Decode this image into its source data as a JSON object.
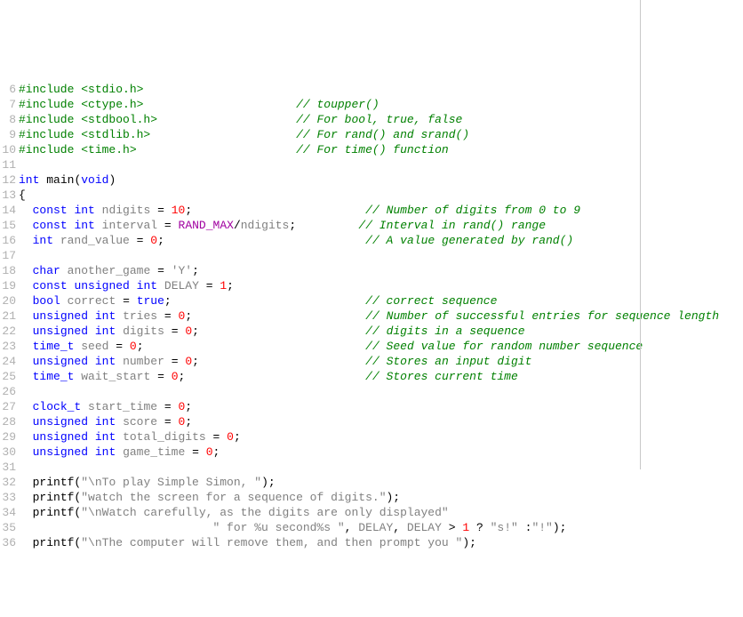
{
  "lines": [
    {
      "n": "6",
      "tokens": [
        [
          "pp",
          "#include "
        ],
        [
          "hdr",
          "<stdio.h>"
        ]
      ]
    },
    {
      "n": "7",
      "tokens": [
        [
          "pp",
          "#include "
        ],
        [
          "hdr",
          "<ctype.h>"
        ],
        [
          "",
          "                      "
        ],
        [
          "cmt",
          "// toupper()"
        ]
      ]
    },
    {
      "n": "8",
      "tokens": [
        [
          "pp",
          "#include "
        ],
        [
          "hdr",
          "<stdbool.h>"
        ],
        [
          "",
          "                    "
        ],
        [
          "cmt",
          "// For bool, true, false"
        ]
      ]
    },
    {
      "n": "9",
      "tokens": [
        [
          "pp",
          "#include "
        ],
        [
          "hdr",
          "<stdlib.h>"
        ],
        [
          "",
          "                     "
        ],
        [
          "cmt",
          "// For rand() and srand()"
        ]
      ]
    },
    {
      "n": "10",
      "tokens": [
        [
          "pp",
          "#include "
        ],
        [
          "hdr",
          "<time.h>"
        ],
        [
          "",
          "                       "
        ],
        [
          "cmt",
          "// For time() function"
        ]
      ]
    },
    {
      "n": "11",
      "tokens": []
    },
    {
      "n": "12",
      "tokens": [
        [
          "kw",
          "int"
        ],
        [
          "",
          " "
        ],
        [
          "fn",
          "main"
        ],
        [
          "op",
          "("
        ],
        [
          "kw",
          "void"
        ],
        [
          "op",
          ")"
        ]
      ]
    },
    {
      "n": "13",
      "tokens": [
        [
          "op",
          "{"
        ]
      ]
    },
    {
      "n": "14",
      "tokens": [
        [
          "",
          "  "
        ],
        [
          "kw",
          "const"
        ],
        [
          "",
          " "
        ],
        [
          "kw",
          "int"
        ],
        [
          "",
          " "
        ],
        [
          "id",
          "ndigits"
        ],
        [
          "",
          " "
        ],
        [
          "op",
          "="
        ],
        [
          "",
          " "
        ],
        [
          "num",
          "10"
        ],
        [
          "op",
          ";"
        ],
        [
          "",
          "                         "
        ],
        [
          "cmt",
          "// Number of digits from 0 to 9"
        ]
      ]
    },
    {
      "n": "15",
      "tokens": [
        [
          "",
          "  "
        ],
        [
          "kw",
          "const"
        ],
        [
          "",
          " "
        ],
        [
          "kw",
          "int"
        ],
        [
          "",
          " "
        ],
        [
          "id",
          "interval"
        ],
        [
          "",
          " "
        ],
        [
          "op",
          "="
        ],
        [
          "",
          " "
        ],
        [
          "mac",
          "RAND_MAX"
        ],
        [
          "op",
          "/"
        ],
        [
          "id",
          "ndigits"
        ],
        [
          "op",
          ";"
        ],
        [
          "",
          "         "
        ],
        [
          "cmt",
          "// Interval in rand() range"
        ]
      ]
    },
    {
      "n": "16",
      "tokens": [
        [
          "",
          "  "
        ],
        [
          "kw",
          "int"
        ],
        [
          "",
          " "
        ],
        [
          "id",
          "rand_value"
        ],
        [
          "",
          " "
        ],
        [
          "op",
          "="
        ],
        [
          "",
          " "
        ],
        [
          "num",
          "0"
        ],
        [
          "op",
          ";"
        ],
        [
          "",
          "                             "
        ],
        [
          "cmt",
          "// A value generated by rand()"
        ]
      ]
    },
    {
      "n": "17",
      "tokens": []
    },
    {
      "n": "18",
      "tokens": [
        [
          "",
          "  "
        ],
        [
          "kw",
          "char"
        ],
        [
          "",
          " "
        ],
        [
          "id",
          "another_game"
        ],
        [
          "",
          " "
        ],
        [
          "op",
          "="
        ],
        [
          "",
          " "
        ],
        [
          "str",
          "'Y'"
        ],
        [
          "op",
          ";"
        ]
      ]
    },
    {
      "n": "19",
      "tokens": [
        [
          "",
          "  "
        ],
        [
          "kw",
          "const"
        ],
        [
          "",
          " "
        ],
        [
          "kw",
          "unsigned"
        ],
        [
          "",
          " "
        ],
        [
          "kw",
          "int"
        ],
        [
          "",
          " "
        ],
        [
          "id",
          "DELAY"
        ],
        [
          "",
          " "
        ],
        [
          "op",
          "="
        ],
        [
          "",
          " "
        ],
        [
          "num",
          "1"
        ],
        [
          "op",
          ";"
        ]
      ]
    },
    {
      "n": "20",
      "tokens": [
        [
          "",
          "  "
        ],
        [
          "kw",
          "bool"
        ],
        [
          "",
          " "
        ],
        [
          "id",
          "correct"
        ],
        [
          "",
          " "
        ],
        [
          "op",
          "="
        ],
        [
          "",
          " "
        ],
        [
          "kw",
          "true"
        ],
        [
          "op",
          ";"
        ],
        [
          "",
          "                            "
        ],
        [
          "cmt",
          "// correct sequence"
        ]
      ]
    },
    {
      "n": "21",
      "tokens": [
        [
          "",
          "  "
        ],
        [
          "kw",
          "unsigned"
        ],
        [
          "",
          " "
        ],
        [
          "kw",
          "int"
        ],
        [
          "",
          " "
        ],
        [
          "id",
          "tries"
        ],
        [
          "",
          " "
        ],
        [
          "op",
          "="
        ],
        [
          "",
          " "
        ],
        [
          "num",
          "0"
        ],
        [
          "op",
          ";"
        ],
        [
          "",
          "                         "
        ],
        [
          "cmt",
          "// Number of successful entries for sequence length"
        ]
      ]
    },
    {
      "n": "22",
      "tokens": [
        [
          "",
          "  "
        ],
        [
          "kw",
          "unsigned"
        ],
        [
          "",
          " "
        ],
        [
          "kw",
          "int"
        ],
        [
          "",
          " "
        ],
        [
          "id",
          "digits"
        ],
        [
          "",
          " "
        ],
        [
          "op",
          "="
        ],
        [
          "",
          " "
        ],
        [
          "num",
          "0"
        ],
        [
          "op",
          ";"
        ],
        [
          "",
          "                        "
        ],
        [
          "cmt",
          "// digits in a sequence"
        ]
      ]
    },
    {
      "n": "23",
      "tokens": [
        [
          "",
          "  "
        ],
        [
          "ty",
          "time_t"
        ],
        [
          "",
          " "
        ],
        [
          "id",
          "seed"
        ],
        [
          "",
          " "
        ],
        [
          "op",
          "="
        ],
        [
          "",
          " "
        ],
        [
          "num",
          "0"
        ],
        [
          "op",
          ";"
        ],
        [
          "",
          "                                "
        ],
        [
          "cmt",
          "// Seed value for random number sequence"
        ]
      ]
    },
    {
      "n": "24",
      "tokens": [
        [
          "",
          "  "
        ],
        [
          "kw",
          "unsigned"
        ],
        [
          "",
          " "
        ],
        [
          "kw",
          "int"
        ],
        [
          "",
          " "
        ],
        [
          "id",
          "number"
        ],
        [
          "",
          " "
        ],
        [
          "op",
          "="
        ],
        [
          "",
          " "
        ],
        [
          "num",
          "0"
        ],
        [
          "op",
          ";"
        ],
        [
          "",
          "                        "
        ],
        [
          "cmt",
          "// Stores an input digit"
        ]
      ]
    },
    {
      "n": "25",
      "tokens": [
        [
          "",
          "  "
        ],
        [
          "ty",
          "time_t"
        ],
        [
          "",
          " "
        ],
        [
          "id",
          "wait_start"
        ],
        [
          "",
          " "
        ],
        [
          "op",
          "="
        ],
        [
          "",
          " "
        ],
        [
          "num",
          "0"
        ],
        [
          "op",
          ";"
        ],
        [
          "",
          "                          "
        ],
        [
          "cmt",
          "// Stores current time"
        ]
      ]
    },
    {
      "n": "26",
      "tokens": []
    },
    {
      "n": "27",
      "tokens": [
        [
          "",
          "  "
        ],
        [
          "ty",
          "clock_t"
        ],
        [
          "",
          " "
        ],
        [
          "id",
          "start_time"
        ],
        [
          "",
          " "
        ],
        [
          "op",
          "="
        ],
        [
          "",
          " "
        ],
        [
          "num",
          "0"
        ],
        [
          "op",
          ";"
        ]
      ]
    },
    {
      "n": "28",
      "tokens": [
        [
          "",
          "  "
        ],
        [
          "kw",
          "unsigned"
        ],
        [
          "",
          " "
        ],
        [
          "kw",
          "int"
        ],
        [
          "",
          " "
        ],
        [
          "id",
          "score"
        ],
        [
          "",
          " "
        ],
        [
          "op",
          "="
        ],
        [
          "",
          " "
        ],
        [
          "num",
          "0"
        ],
        [
          "op",
          ";"
        ]
      ]
    },
    {
      "n": "29",
      "tokens": [
        [
          "",
          "  "
        ],
        [
          "kw",
          "unsigned"
        ],
        [
          "",
          " "
        ],
        [
          "kw",
          "int"
        ],
        [
          "",
          " "
        ],
        [
          "id",
          "total_digits"
        ],
        [
          "",
          " "
        ],
        [
          "op",
          "="
        ],
        [
          "",
          " "
        ],
        [
          "num",
          "0"
        ],
        [
          "op",
          ";"
        ]
      ]
    },
    {
      "n": "30",
      "tokens": [
        [
          "",
          "  "
        ],
        [
          "kw",
          "unsigned"
        ],
        [
          "",
          " "
        ],
        [
          "kw",
          "int"
        ],
        [
          "",
          " "
        ],
        [
          "id",
          "game_time"
        ],
        [
          "",
          " "
        ],
        [
          "op",
          "="
        ],
        [
          "",
          " "
        ],
        [
          "num",
          "0"
        ],
        [
          "op",
          ";"
        ]
      ]
    },
    {
      "n": "31",
      "tokens": []
    },
    {
      "n": "32",
      "tokens": [
        [
          "",
          "  "
        ],
        [
          "fn",
          "printf"
        ],
        [
          "op",
          "("
        ],
        [
          "str",
          "\"\\nTo play Simple Simon, \""
        ],
        [
          "op",
          ");"
        ]
      ]
    },
    {
      "n": "33",
      "tokens": [
        [
          "",
          "  "
        ],
        [
          "fn",
          "printf"
        ],
        [
          "op",
          "("
        ],
        [
          "str",
          "\"watch the screen for a sequence of digits.\""
        ],
        [
          "op",
          ");"
        ]
      ]
    },
    {
      "n": "34",
      "tokens": [
        [
          "",
          "  "
        ],
        [
          "fn",
          "printf"
        ],
        [
          "op",
          "("
        ],
        [
          "str",
          "\"\\nWatch carefully, as the digits are only displayed\""
        ]
      ]
    },
    {
      "n": "35",
      "tokens": [
        [
          "",
          "                            "
        ],
        [
          "str",
          "\" for %u second%s \""
        ],
        [
          "op",
          ", "
        ],
        [
          "id",
          "DELAY"
        ],
        [
          "op",
          ", "
        ],
        [
          "id",
          "DELAY"
        ],
        [
          "",
          " "
        ],
        [
          "op",
          ">"
        ],
        [
          "",
          " "
        ],
        [
          "num",
          "1"
        ],
        [
          "",
          " "
        ],
        [
          "op",
          "?"
        ],
        [
          "",
          " "
        ],
        [
          "str",
          "\"s!\""
        ],
        [
          "",
          " "
        ],
        [
          "op",
          ":"
        ],
        [
          "str",
          "\"!\""
        ],
        [
          "op",
          ");"
        ]
      ]
    },
    {
      "n": "36",
      "tokens": [
        [
          "",
          "  "
        ],
        [
          "fn",
          "printf"
        ],
        [
          "op",
          "("
        ],
        [
          "str",
          "\"\\nThe computer will remove them, and then prompt you \""
        ],
        [
          "op",
          ");"
        ]
      ]
    }
  ]
}
